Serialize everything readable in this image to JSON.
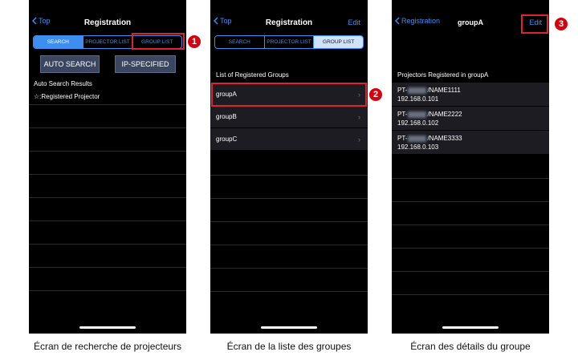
{
  "screens": [
    {
      "back_label": "Top",
      "title": "Registration",
      "tabs": [
        "SEARCH",
        "PROJECTOR LIST",
        "GROUP LIST"
      ],
      "active_tab": "SEARCH",
      "buttons": {
        "auto_search": "AUTO SEARCH",
        "ip_specified": "IP-SPECIFIED"
      },
      "results_title": "Auto Search Results",
      "results_legend": "☆:Registered Projector",
      "callout": "1",
      "caption": "Écran de recherche de projecteurs"
    },
    {
      "back_label": "Top",
      "title": "Registration",
      "edit_label": "Edit",
      "tabs": [
        "SEARCH",
        "PROJECTOR LIST",
        "GROUP LIST"
      ],
      "active_tab": "GROUP LIST",
      "list_title": "List of Registered Groups",
      "groups": [
        "groupA",
        "groupB",
        "groupC"
      ],
      "callout": "2",
      "caption": "Écran de la liste des groupes"
    },
    {
      "back_label": "Registration",
      "title": "groupA",
      "edit_label": "Edit",
      "list_title": "Projectors Registered in groupA",
      "projectors": [
        {
          "model_prefix": "PT-",
          "name": "/NAME1111",
          "ip": "192.168.0.101"
        },
        {
          "model_prefix": "PT-",
          "name": "/NAME2222",
          "ip": "192.168.0.102"
        },
        {
          "model_prefix": "PT-",
          "name": "/NAME3333",
          "ip": "192.168.0.103"
        }
      ],
      "callout": "3",
      "caption": "Écran des détails du groupe"
    }
  ],
  "colors": {
    "accent": "#3d8ef0",
    "highlight": "#e0222a",
    "badge": "#d6000f"
  }
}
